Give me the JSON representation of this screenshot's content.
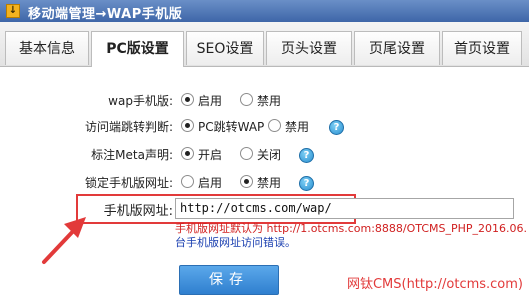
{
  "window": {
    "title": "移动端管理→WAP手机版"
  },
  "tabs": [
    {
      "label": "基本信息"
    },
    {
      "label": "PC版设置"
    },
    {
      "label": "SEO设置"
    },
    {
      "label": "页头设置"
    },
    {
      "label": "页尾设置"
    },
    {
      "label": "首页设置"
    }
  ],
  "form": {
    "wap_mode": {
      "label": "wap手机版:",
      "opt1": "启用",
      "opt2": "禁用",
      "selected": "启用"
    },
    "redirect": {
      "label": "访问端跳转判断:",
      "opt1": "PC跳转WAP",
      "opt2": "禁用",
      "selected": "PC跳转WAP"
    },
    "meta": {
      "label": "标注Meta声明:",
      "opt1": "开启",
      "opt2": "关闭",
      "selected": "开启"
    },
    "lock_url": {
      "label": "锁定手机版网址:",
      "opt1": "启用",
      "opt2": "禁用",
      "selected": "禁用"
    },
    "mobile_url": {
      "label": "手机版网址:",
      "value": "http://otcms.com/wap/",
      "hint_line1": "手机版网址默认为  http://1.otcms.com:8888/OTCMS_PHP_2016.06.",
      "hint_line2": "台手机版网址访问错误。"
    }
  },
  "buttons": {
    "save": "保存"
  },
  "watermark": "网钛CMS(http://otcms.com)"
}
